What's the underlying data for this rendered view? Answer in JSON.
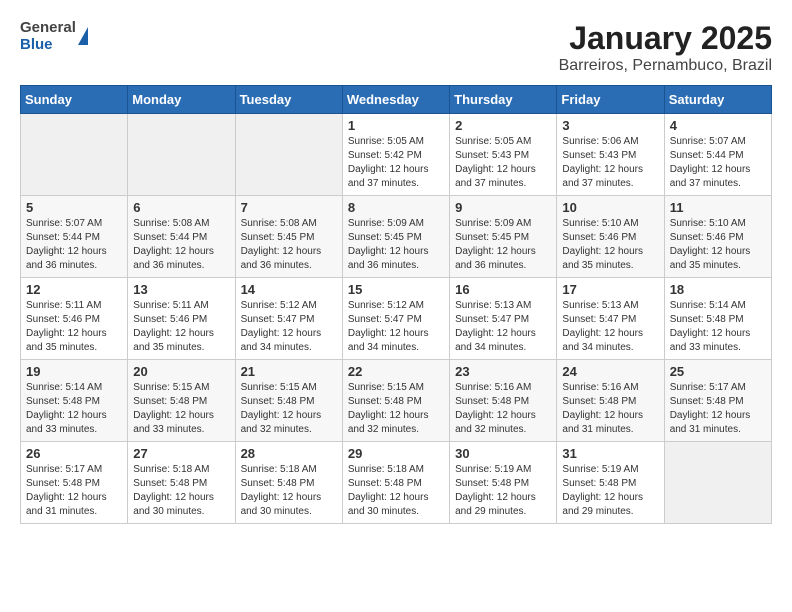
{
  "header": {
    "logo_line1": "General",
    "logo_line2": "Blue",
    "title": "January 2025",
    "subtitle": "Barreiros, Pernambuco, Brazil"
  },
  "calendar": {
    "days_of_week": [
      "Sunday",
      "Monday",
      "Tuesday",
      "Wednesday",
      "Thursday",
      "Friday",
      "Saturday"
    ],
    "weeks": [
      [
        {
          "day": "",
          "info": ""
        },
        {
          "day": "",
          "info": ""
        },
        {
          "day": "",
          "info": ""
        },
        {
          "day": "1",
          "info": "Sunrise: 5:05 AM\nSunset: 5:42 PM\nDaylight: 12 hours\nand 37 minutes."
        },
        {
          "day": "2",
          "info": "Sunrise: 5:05 AM\nSunset: 5:43 PM\nDaylight: 12 hours\nand 37 minutes."
        },
        {
          "day": "3",
          "info": "Sunrise: 5:06 AM\nSunset: 5:43 PM\nDaylight: 12 hours\nand 37 minutes."
        },
        {
          "day": "4",
          "info": "Sunrise: 5:07 AM\nSunset: 5:44 PM\nDaylight: 12 hours\nand 37 minutes."
        }
      ],
      [
        {
          "day": "5",
          "info": "Sunrise: 5:07 AM\nSunset: 5:44 PM\nDaylight: 12 hours\nand 36 minutes."
        },
        {
          "day": "6",
          "info": "Sunrise: 5:08 AM\nSunset: 5:44 PM\nDaylight: 12 hours\nand 36 minutes."
        },
        {
          "day": "7",
          "info": "Sunrise: 5:08 AM\nSunset: 5:45 PM\nDaylight: 12 hours\nand 36 minutes."
        },
        {
          "day": "8",
          "info": "Sunrise: 5:09 AM\nSunset: 5:45 PM\nDaylight: 12 hours\nand 36 minutes."
        },
        {
          "day": "9",
          "info": "Sunrise: 5:09 AM\nSunset: 5:45 PM\nDaylight: 12 hours\nand 36 minutes."
        },
        {
          "day": "10",
          "info": "Sunrise: 5:10 AM\nSunset: 5:46 PM\nDaylight: 12 hours\nand 35 minutes."
        },
        {
          "day": "11",
          "info": "Sunrise: 5:10 AM\nSunset: 5:46 PM\nDaylight: 12 hours\nand 35 minutes."
        }
      ],
      [
        {
          "day": "12",
          "info": "Sunrise: 5:11 AM\nSunset: 5:46 PM\nDaylight: 12 hours\nand 35 minutes."
        },
        {
          "day": "13",
          "info": "Sunrise: 5:11 AM\nSunset: 5:46 PM\nDaylight: 12 hours\nand 35 minutes."
        },
        {
          "day": "14",
          "info": "Sunrise: 5:12 AM\nSunset: 5:47 PM\nDaylight: 12 hours\nand 34 minutes."
        },
        {
          "day": "15",
          "info": "Sunrise: 5:12 AM\nSunset: 5:47 PM\nDaylight: 12 hours\nand 34 minutes."
        },
        {
          "day": "16",
          "info": "Sunrise: 5:13 AM\nSunset: 5:47 PM\nDaylight: 12 hours\nand 34 minutes."
        },
        {
          "day": "17",
          "info": "Sunrise: 5:13 AM\nSunset: 5:47 PM\nDaylight: 12 hours\nand 34 minutes."
        },
        {
          "day": "18",
          "info": "Sunrise: 5:14 AM\nSunset: 5:48 PM\nDaylight: 12 hours\nand 33 minutes."
        }
      ],
      [
        {
          "day": "19",
          "info": "Sunrise: 5:14 AM\nSunset: 5:48 PM\nDaylight: 12 hours\nand 33 minutes."
        },
        {
          "day": "20",
          "info": "Sunrise: 5:15 AM\nSunset: 5:48 PM\nDaylight: 12 hours\nand 33 minutes."
        },
        {
          "day": "21",
          "info": "Sunrise: 5:15 AM\nSunset: 5:48 PM\nDaylight: 12 hours\nand 32 minutes."
        },
        {
          "day": "22",
          "info": "Sunrise: 5:15 AM\nSunset: 5:48 PM\nDaylight: 12 hours\nand 32 minutes."
        },
        {
          "day": "23",
          "info": "Sunrise: 5:16 AM\nSunset: 5:48 PM\nDaylight: 12 hours\nand 32 minutes."
        },
        {
          "day": "24",
          "info": "Sunrise: 5:16 AM\nSunset: 5:48 PM\nDaylight: 12 hours\nand 31 minutes."
        },
        {
          "day": "25",
          "info": "Sunrise: 5:17 AM\nSunset: 5:48 PM\nDaylight: 12 hours\nand 31 minutes."
        }
      ],
      [
        {
          "day": "26",
          "info": "Sunrise: 5:17 AM\nSunset: 5:48 PM\nDaylight: 12 hours\nand 31 minutes."
        },
        {
          "day": "27",
          "info": "Sunrise: 5:18 AM\nSunset: 5:48 PM\nDaylight: 12 hours\nand 30 minutes."
        },
        {
          "day": "28",
          "info": "Sunrise: 5:18 AM\nSunset: 5:48 PM\nDaylight: 12 hours\nand 30 minutes."
        },
        {
          "day": "29",
          "info": "Sunrise: 5:18 AM\nSunset: 5:48 PM\nDaylight: 12 hours\nand 30 minutes."
        },
        {
          "day": "30",
          "info": "Sunrise: 5:19 AM\nSunset: 5:48 PM\nDaylight: 12 hours\nand 29 minutes."
        },
        {
          "day": "31",
          "info": "Sunrise: 5:19 AM\nSunset: 5:48 PM\nDaylight: 12 hours\nand 29 minutes."
        },
        {
          "day": "",
          "info": ""
        }
      ]
    ]
  }
}
